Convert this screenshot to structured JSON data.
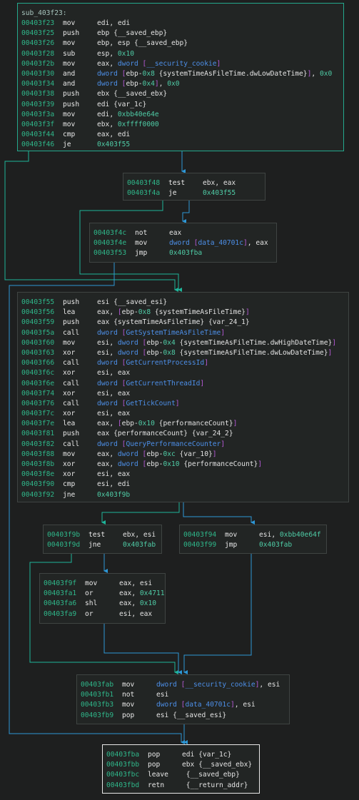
{
  "colors": {
    "background": "#1e1f1f",
    "block_bg": "#222524",
    "block_border": "#3f4442",
    "entry_border": "#24a88d",
    "exit_border": "#e8e8e8",
    "address": "#2fb78a",
    "symbol": "#4d8fe8",
    "number": "#4fcca6",
    "bracket": "#b65ad6",
    "edge_true": "#1fb59a",
    "edge_false": "#2d97d6",
    "edge_uncond": "#2d97d6"
  },
  "function_label": "sub_403f23:",
  "blocks": [
    {
      "id": "b0",
      "lines": [
        {
          "addr": "00403f23",
          "mnemonic": "mov",
          "tokens": [
            {
              "t": "edi, edi",
              "c": "plain"
            }
          ]
        },
        {
          "addr": "00403f25",
          "mnemonic": "push",
          "tokens": [
            {
              "t": "ebp {__saved_ebp}",
              "c": "plain"
            }
          ]
        },
        {
          "addr": "00403f26",
          "mnemonic": "mov",
          "tokens": [
            {
              "t": "ebp, esp {__saved_ebp}",
              "c": "plain"
            }
          ]
        },
        {
          "addr": "00403f28",
          "mnemonic": "sub",
          "tokens": [
            {
              "t": "esp, ",
              "c": "plain"
            },
            {
              "t": "0x10",
              "c": "num"
            }
          ]
        },
        {
          "addr": "00403f2b",
          "mnemonic": "mov",
          "tokens": [
            {
              "t": "eax, ",
              "c": "plain"
            },
            {
              "t": "dword ",
              "c": "sym"
            },
            {
              "t": "[",
              "c": "br"
            },
            {
              "t": "__security_cookie",
              "c": "sym"
            },
            {
              "t": "]",
              "c": "br"
            }
          ]
        },
        {
          "addr": "00403f30",
          "mnemonic": "and",
          "tokens": [
            {
              "t": "dword ",
              "c": "sym"
            },
            {
              "t": "[",
              "c": "br"
            },
            {
              "t": "ebp-",
              "c": "plain"
            },
            {
              "t": "0x8",
              "c": "num"
            },
            {
              "t": " {systemTimeAsFileTime.dwLowDateTime}",
              "c": "plain"
            },
            {
              "t": "]",
              "c": "br"
            },
            {
              "t": ", ",
              "c": "plain"
            },
            {
              "t": "0x0",
              "c": "num"
            }
          ]
        },
        {
          "addr": "00403f34",
          "mnemonic": "and",
          "tokens": [
            {
              "t": "dword ",
              "c": "sym"
            },
            {
              "t": "[",
              "c": "br"
            },
            {
              "t": "ebp-",
              "c": "plain"
            },
            {
              "t": "0x4",
              "c": "num"
            },
            {
              "t": "]",
              "c": "br"
            },
            {
              "t": ", ",
              "c": "plain"
            },
            {
              "t": "0x0",
              "c": "num"
            }
          ]
        },
        {
          "addr": "00403f38",
          "mnemonic": "push",
          "tokens": [
            {
              "t": "ebx {__saved_ebx}",
              "c": "plain"
            }
          ]
        },
        {
          "addr": "00403f39",
          "mnemonic": "push",
          "tokens": [
            {
              "t": "edi {var_1c}",
              "c": "plain"
            }
          ]
        },
        {
          "addr": "00403f3a",
          "mnemonic": "mov",
          "tokens": [
            {
              "t": "edi, ",
              "c": "plain"
            },
            {
              "t": "0xbb40e64e",
              "c": "num"
            }
          ]
        },
        {
          "addr": "00403f3f",
          "mnemonic": "mov",
          "tokens": [
            {
              "t": "ebx, ",
              "c": "plain"
            },
            {
              "t": "0xffff0000",
              "c": "num"
            }
          ]
        },
        {
          "addr": "00403f44",
          "mnemonic": "cmp",
          "tokens": [
            {
              "t": "eax, edi",
              "c": "plain"
            }
          ]
        },
        {
          "addr": "00403f46",
          "mnemonic": "je",
          "tokens": [
            {
              "t": "0x403f55",
              "c": "num"
            }
          ]
        }
      ]
    },
    {
      "id": "b1",
      "lines": [
        {
          "addr": "00403f48",
          "mnemonic": "test",
          "tokens": [
            {
              "t": "ebx, eax",
              "c": "plain"
            }
          ]
        },
        {
          "addr": "00403f4a",
          "mnemonic": "je",
          "tokens": [
            {
              "t": "0x403f55",
              "c": "num"
            }
          ]
        }
      ]
    },
    {
      "id": "b2",
      "lines": [
        {
          "addr": "00403f4c",
          "mnemonic": "not",
          "tokens": [
            {
              "t": "eax",
              "c": "plain"
            }
          ]
        },
        {
          "addr": "00403f4e",
          "mnemonic": "mov",
          "tokens": [
            {
              "t": "dword ",
              "c": "sym"
            },
            {
              "t": "[",
              "c": "br"
            },
            {
              "t": "data_40701c",
              "c": "sym"
            },
            {
              "t": "]",
              "c": "br"
            },
            {
              "t": ", eax",
              "c": "plain"
            }
          ]
        },
        {
          "addr": "00403f53",
          "mnemonic": "jmp",
          "tokens": [
            {
              "t": "0x403fba",
              "c": "num"
            }
          ]
        }
      ]
    },
    {
      "id": "b3",
      "lines": [
        {
          "addr": "00403f55",
          "mnemonic": "push",
          "tokens": [
            {
              "t": "esi {__saved_esi}",
              "c": "plain"
            }
          ]
        },
        {
          "addr": "00403f56",
          "mnemonic": "lea",
          "tokens": [
            {
              "t": "eax, ",
              "c": "plain"
            },
            {
              "t": "[",
              "c": "br"
            },
            {
              "t": "ebp-",
              "c": "plain"
            },
            {
              "t": "0x8",
              "c": "num"
            },
            {
              "t": " {systemTimeAsFileTime}",
              "c": "plain"
            },
            {
              "t": "]",
              "c": "br"
            }
          ]
        },
        {
          "addr": "00403f59",
          "mnemonic": "push",
          "tokens": [
            {
              "t": "eax {systemTimeAsFileTime} {var_24_1}",
              "c": "plain"
            }
          ]
        },
        {
          "addr": "00403f5a",
          "mnemonic": "call",
          "tokens": [
            {
              "t": "dword ",
              "c": "sym"
            },
            {
              "t": "[",
              "c": "br"
            },
            {
              "t": "GetSystemTimeAsFileTime",
              "c": "sym"
            },
            {
              "t": "]",
              "c": "br"
            }
          ]
        },
        {
          "addr": "00403f60",
          "mnemonic": "mov",
          "tokens": [
            {
              "t": "esi, ",
              "c": "plain"
            },
            {
              "t": "dword ",
              "c": "sym"
            },
            {
              "t": "[",
              "c": "br"
            },
            {
              "t": "ebp-",
              "c": "plain"
            },
            {
              "t": "0x4",
              "c": "num"
            },
            {
              "t": " {systemTimeAsFileTime.dwHighDateTime}",
              "c": "plain"
            },
            {
              "t": "]",
              "c": "br"
            }
          ]
        },
        {
          "addr": "00403f63",
          "mnemonic": "xor",
          "tokens": [
            {
              "t": "esi, ",
              "c": "plain"
            },
            {
              "t": "dword ",
              "c": "sym"
            },
            {
              "t": "[",
              "c": "br"
            },
            {
              "t": "ebp-",
              "c": "plain"
            },
            {
              "t": "0x8",
              "c": "num"
            },
            {
              "t": " {systemTimeAsFileTime.dwLowDateTime}",
              "c": "plain"
            },
            {
              "t": "]",
              "c": "br"
            }
          ]
        },
        {
          "addr": "00403f66",
          "mnemonic": "call",
          "tokens": [
            {
              "t": "dword ",
              "c": "sym"
            },
            {
              "t": "[",
              "c": "br"
            },
            {
              "t": "GetCurrentProcessId",
              "c": "sym"
            },
            {
              "t": "]",
              "c": "br"
            }
          ]
        },
        {
          "addr": "00403f6c",
          "mnemonic": "xor",
          "tokens": [
            {
              "t": "esi, eax",
              "c": "plain"
            }
          ]
        },
        {
          "addr": "00403f6e",
          "mnemonic": "call",
          "tokens": [
            {
              "t": "dword ",
              "c": "sym"
            },
            {
              "t": "[",
              "c": "br"
            },
            {
              "t": "GetCurrentThreadId",
              "c": "sym"
            },
            {
              "t": "]",
              "c": "br"
            }
          ]
        },
        {
          "addr": "00403f74",
          "mnemonic": "xor",
          "tokens": [
            {
              "t": "esi, eax",
              "c": "plain"
            }
          ]
        },
        {
          "addr": "00403f76",
          "mnemonic": "call",
          "tokens": [
            {
              "t": "dword ",
              "c": "sym"
            },
            {
              "t": "[",
              "c": "br"
            },
            {
              "t": "GetTickCount",
              "c": "sym"
            },
            {
              "t": "]",
              "c": "br"
            }
          ]
        },
        {
          "addr": "00403f7c",
          "mnemonic": "xor",
          "tokens": [
            {
              "t": "esi, eax",
              "c": "plain"
            }
          ]
        },
        {
          "addr": "00403f7e",
          "mnemonic": "lea",
          "tokens": [
            {
              "t": "eax, ",
              "c": "plain"
            },
            {
              "t": "[",
              "c": "br"
            },
            {
              "t": "ebp-",
              "c": "plain"
            },
            {
              "t": "0x10",
              "c": "num"
            },
            {
              "t": " {performanceCount}",
              "c": "plain"
            },
            {
              "t": "]",
              "c": "br"
            }
          ]
        },
        {
          "addr": "00403f81",
          "mnemonic": "push",
          "tokens": [
            {
              "t": "eax {performanceCount} {var_24_2}",
              "c": "plain"
            }
          ]
        },
        {
          "addr": "00403f82",
          "mnemonic": "call",
          "tokens": [
            {
              "t": "dword ",
              "c": "sym"
            },
            {
              "t": "[",
              "c": "br"
            },
            {
              "t": "QueryPerformanceCounter",
              "c": "sym"
            },
            {
              "t": "]",
              "c": "br"
            }
          ]
        },
        {
          "addr": "00403f88",
          "mnemonic": "mov",
          "tokens": [
            {
              "t": "eax, ",
              "c": "plain"
            },
            {
              "t": "dword ",
              "c": "sym"
            },
            {
              "t": "[",
              "c": "br"
            },
            {
              "t": "ebp-",
              "c": "plain"
            },
            {
              "t": "0xc",
              "c": "num"
            },
            {
              "t": " {var_10}",
              "c": "plain"
            },
            {
              "t": "]",
              "c": "br"
            }
          ]
        },
        {
          "addr": "00403f8b",
          "mnemonic": "xor",
          "tokens": [
            {
              "t": "eax, ",
              "c": "plain"
            },
            {
              "t": "dword ",
              "c": "sym"
            },
            {
              "t": "[",
              "c": "br"
            },
            {
              "t": "ebp-",
              "c": "plain"
            },
            {
              "t": "0x10",
              "c": "num"
            },
            {
              "t": " {performanceCount}",
              "c": "plain"
            },
            {
              "t": "]",
              "c": "br"
            }
          ]
        },
        {
          "addr": "00403f8e",
          "mnemonic": "xor",
          "tokens": [
            {
              "t": "esi, eax",
              "c": "plain"
            }
          ]
        },
        {
          "addr": "00403f90",
          "mnemonic": "cmp",
          "tokens": [
            {
              "t": "esi, edi",
              "c": "plain"
            }
          ]
        },
        {
          "addr": "00403f92",
          "mnemonic": "jne",
          "tokens": [
            {
              "t": "0x403f9b",
              "c": "num"
            }
          ]
        }
      ]
    },
    {
      "id": "b4",
      "lines": [
        {
          "addr": "00403f9b",
          "mnemonic": "test",
          "tokens": [
            {
              "t": "ebx, esi",
              "c": "plain"
            }
          ]
        },
        {
          "addr": "00403f9d",
          "mnemonic": "jne",
          "tokens": [
            {
              "t": "0x403fab",
              "c": "num"
            }
          ]
        }
      ]
    },
    {
      "id": "b5",
      "lines": [
        {
          "addr": "00403f94",
          "mnemonic": "mov",
          "tokens": [
            {
              "t": "esi, ",
              "c": "plain"
            },
            {
              "t": "0xbb40e64f",
              "c": "num"
            }
          ]
        },
        {
          "addr": "00403f99",
          "mnemonic": "jmp",
          "tokens": [
            {
              "t": "0x403fab",
              "c": "num"
            }
          ]
        }
      ]
    },
    {
      "id": "b6",
      "lines": [
        {
          "addr": "00403f9f",
          "mnemonic": "mov",
          "tokens": [
            {
              "t": "eax, esi",
              "c": "plain"
            }
          ]
        },
        {
          "addr": "00403fa1",
          "mnemonic": "or",
          "tokens": [
            {
              "t": "eax, ",
              "c": "plain"
            },
            {
              "t": "0x4711",
              "c": "num"
            }
          ]
        },
        {
          "addr": "00403fa6",
          "mnemonic": "shl",
          "tokens": [
            {
              "t": "eax, ",
              "c": "plain"
            },
            {
              "t": "0x10",
              "c": "num"
            }
          ]
        },
        {
          "addr": "00403fa9",
          "mnemonic": "or",
          "tokens": [
            {
              "t": "esi, eax",
              "c": "plain"
            }
          ]
        }
      ]
    },
    {
      "id": "b7",
      "lines": [
        {
          "addr": "00403fab",
          "mnemonic": "mov",
          "tokens": [
            {
              "t": "dword ",
              "c": "sym"
            },
            {
              "t": "[",
              "c": "br"
            },
            {
              "t": "__security_cookie",
              "c": "sym"
            },
            {
              "t": "]",
              "c": "br"
            },
            {
              "t": ", esi",
              "c": "plain"
            }
          ]
        },
        {
          "addr": "00403fb1",
          "mnemonic": "not",
          "tokens": [
            {
              "t": "esi",
              "c": "plain"
            }
          ]
        },
        {
          "addr": "00403fb3",
          "mnemonic": "mov",
          "tokens": [
            {
              "t": "dword ",
              "c": "sym"
            },
            {
              "t": "[",
              "c": "br"
            },
            {
              "t": "data_40701c",
              "c": "sym"
            },
            {
              "t": "]",
              "c": "br"
            },
            {
              "t": ", esi",
              "c": "plain"
            }
          ]
        },
        {
          "addr": "00403fb9",
          "mnemonic": "pop",
          "tokens": [
            {
              "t": "esi {__saved_esi}",
              "c": "plain"
            }
          ]
        }
      ]
    },
    {
      "id": "b8",
      "lines": [
        {
          "addr": "00403fba",
          "mnemonic": "pop",
          "tokens": [
            {
              "t": "edi {var_1c}",
              "c": "plain"
            }
          ]
        },
        {
          "addr": "00403fbb",
          "mnemonic": "pop",
          "tokens": [
            {
              "t": "ebx {__saved_ebx}",
              "c": "plain"
            }
          ]
        },
        {
          "addr": "00403fbc",
          "mnemonic": "leave",
          "tokens": [
            {
              "t": " {__saved_ebp}",
              "c": "plain"
            }
          ]
        },
        {
          "addr": "00403fbd",
          "mnemonic": "retn",
          "tokens": [
            {
              "t": " {__return_addr}",
              "c": "plain"
            }
          ]
        }
      ]
    }
  ]
}
